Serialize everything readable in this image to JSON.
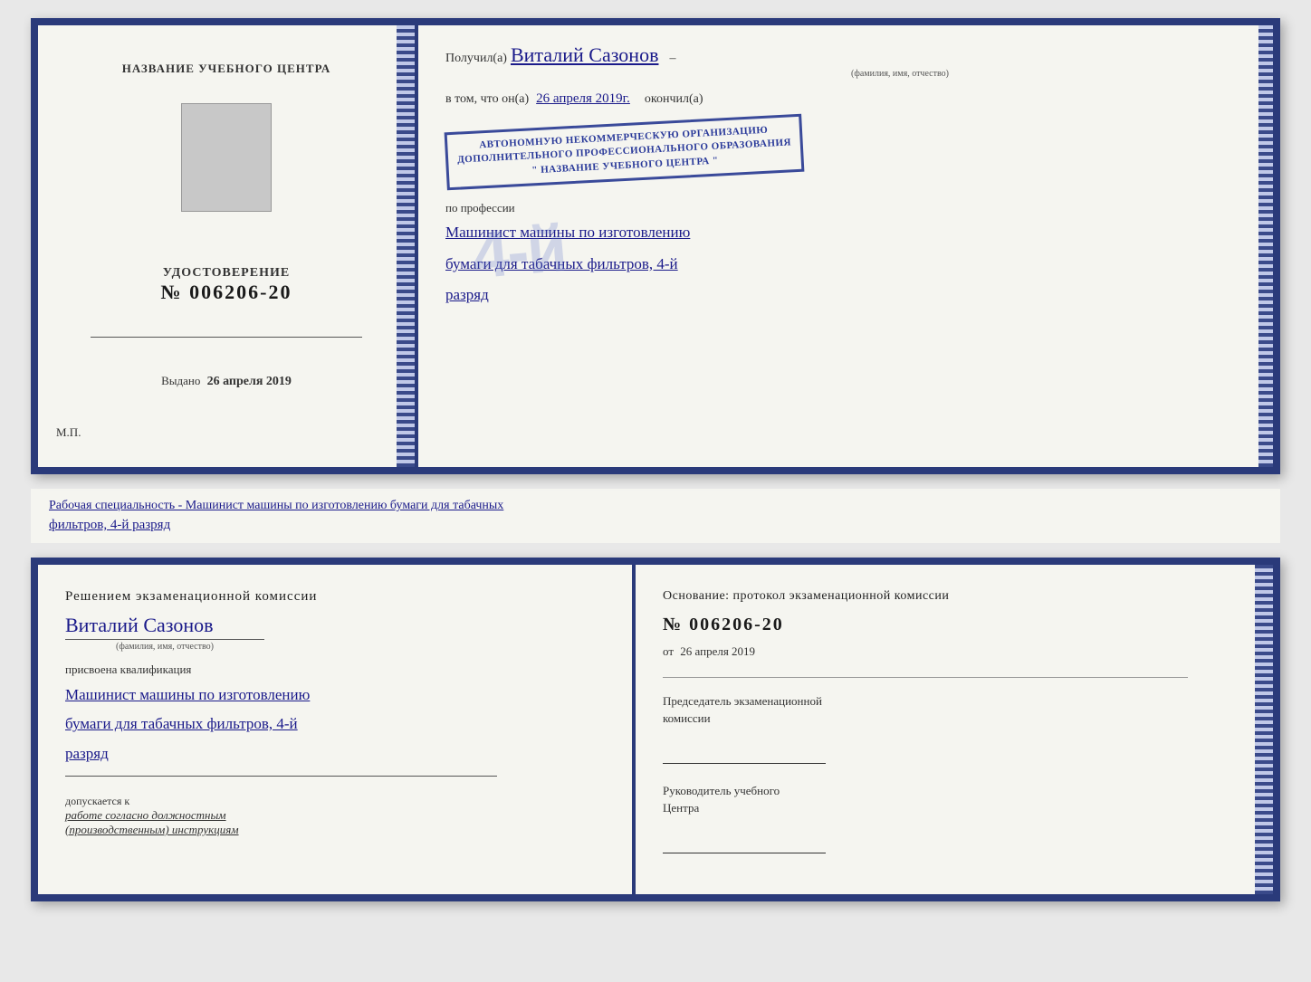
{
  "top_left": {
    "training_center_label": "НАЗВАНИЕ УЧЕБНОГО ЦЕНТРА",
    "certificate_label": "УДОСТОВЕРЕНИЕ",
    "certificate_number": "№ 006206-20",
    "issued_label": "Выдано",
    "issued_date": "26 апреля 2019",
    "mp_label": "М.П."
  },
  "top_right": {
    "received_label": "Получил(а)",
    "recipient_name": "Виталий Сазонов",
    "recipient_subtitle": "(фамилия, имя, отчество)",
    "vtom_label": "в том, что он(а)",
    "vtom_date": "26 апреля 2019г.",
    "finished_label": "окончил(а)",
    "big_number": "4-й",
    "stamp_line1": "АВТОНОМНУЮ НЕКОММЕРЧЕСКУЮ ОРГАНИЗАЦИЮ",
    "stamp_line2": "ДОПОЛНИТЕЛЬНОГО ПРОФЕССИОНАЛЬНОГО ОБРАЗОВАНИЯ",
    "stamp_line3": "\" НАЗВАНИЕ УЧЕБНОГО ЦЕНТРА \"",
    "profession_label": "по профессии",
    "profession_handwritten": "Машинист машины по изготовлению",
    "profession_handwritten2": "бумаги для табачных фильтров, 4-й",
    "profession_handwritten3": "разряд"
  },
  "middle": {
    "text_prefix": "Рабочая специальность - Машинист машины по изготовлению бумаги для табачных",
    "text_underlined": "фильтров, 4-й разряд"
  },
  "bottom_left": {
    "resolution_title": "Решением  экзаменационной  комиссии",
    "name_handwritten": "Виталий Сазонов",
    "name_subtitle": "(фамилия, имя, отчество)",
    "qualification_label": "присвоена квалификация",
    "qualification_line1": "Машинист машины по изготовлению",
    "qualification_line2": "бумаги для табачных фильтров, 4-й",
    "qualification_line3": "разряд",
    "допускается_label": "допускается к",
    "допускается_value": "работе согласно должностным\n(производственным) инструкциям"
  },
  "bottom_right": {
    "основание_label": "Основание:  протокол  экзаменационной  комиссии",
    "protocol_number": "№  006206-20",
    "ot_label": "от",
    "ot_date": "26 апреля 2019",
    "chairman_label": "Председатель экзаменационной\nкомиссии",
    "head_label": "Руководитель учебного\nЦентра"
  },
  "colors": {
    "border": "#2a3a7a",
    "handwriting": "#1a1a8a",
    "text": "#222222",
    "background": "#f5f5f0"
  }
}
